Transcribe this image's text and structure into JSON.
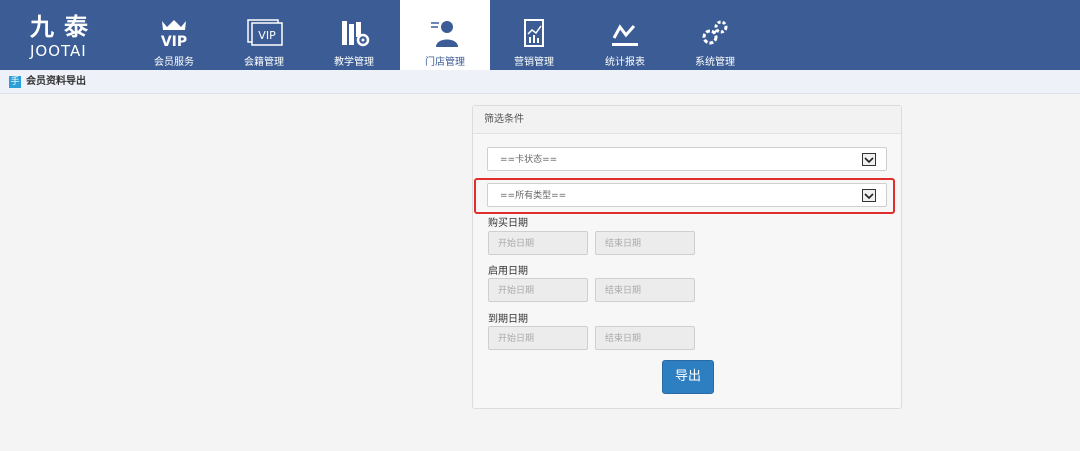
{
  "logo": {
    "cn": "九泰",
    "en": "JOOTAI"
  },
  "nav": [
    {
      "label": "会员服务",
      "icon": "vip-crown-icon"
    },
    {
      "label": "会籍管理",
      "icon": "vip-card-icon"
    },
    {
      "label": "教学管理",
      "icon": "books-gear-icon"
    },
    {
      "label": "门店管理",
      "icon": "user-admin-icon",
      "active": true
    },
    {
      "label": "营销管理",
      "icon": "chart-board-icon"
    },
    {
      "label": "统计报表",
      "icon": "line-chart-icon"
    },
    {
      "label": "系统管理",
      "icon": "gears-icon"
    }
  ],
  "breadcrumb": {
    "icon_glyph": "手",
    "title": "会员资料导出"
  },
  "filter": {
    "title": "筛选条件",
    "card_status": "==卡状态==",
    "card_type": "==所有类型==",
    "groups": [
      {
        "label": "购买日期",
        "start": "开始日期",
        "end": "结束日期"
      },
      {
        "label": "启用日期",
        "start": "开始日期",
        "end": "结束日期"
      },
      {
        "label": "到期日期",
        "start": "开始日期",
        "end": "结束日期"
      }
    ],
    "export_label": "导出"
  },
  "colors": {
    "topbar": "#3b5c95",
    "accent": "#2e7fc2",
    "highlight": "#e02d2d"
  }
}
